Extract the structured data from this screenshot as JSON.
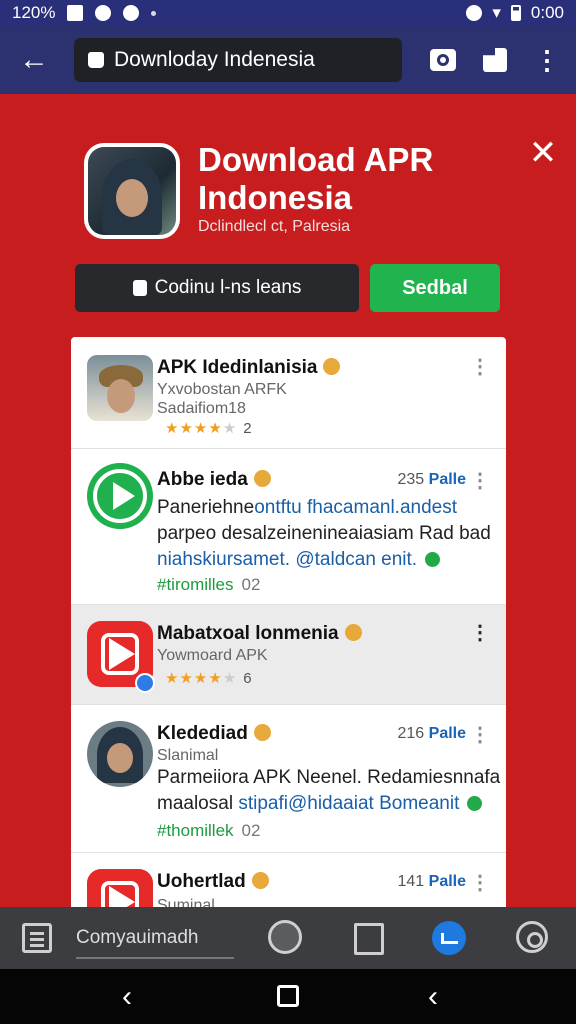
{
  "status_bar": {
    "time_left": "120%",
    "time_right": "0:00"
  },
  "appbar": {
    "search_text": "Downloday Indenesia"
  },
  "hero": {
    "title": "Download APR Indonesia",
    "subtitle": "Dclindlecl ct, Palresia",
    "primary_button": "Codinu l-ns leans",
    "secondary_button": "Sedbal"
  },
  "list": [
    {
      "title": "APK Idedinlanisia",
      "line1": "Yxvobostan ARFK",
      "line2": "Sadaifiom18",
      "rating": "2"
    },
    {
      "title": "Abbe ieda",
      "size_num": "235",
      "size_label": "Palle",
      "desc1": "Panerieh­ne",
      "desc1_hl": "ontftu fhacamanl.andest",
      "desc2": "parpeo desalzeinenineaiasiam Rad bad",
      "desc3_hl": "niahskiursamet. @taldcan enit.",
      "tag": "#tiromilles",
      "tag_num": "02"
    },
    {
      "title": "Mabatxoal lonmenia",
      "line1": "Yowmoard APK",
      "rating": "6"
    },
    {
      "title": "Kledediad",
      "size_num": "216",
      "size_label": "Palle",
      "line1": "Slanimal",
      "desc1": "Parmeiiora APK Neenel. Redamiesnnafa",
      "desc2": "maalosal",
      "desc2_hl": "stipafi@hidaaiat Bomeanit",
      "tag": "#thomillek",
      "tag_num": "02"
    },
    {
      "title": "Uohertlad",
      "size_num": "141",
      "size_label": "Palle",
      "line1": "Suminal"
    }
  ],
  "toolbar": {
    "input_text": "Comyauimadh"
  },
  "icons": [
    "back-arrow-icon",
    "lock-icon",
    "camera-icon",
    "share-icon",
    "more-icon",
    "close-icon",
    "document-icon",
    "clock-icon",
    "flag-icon",
    "check-icon",
    "settings-icon"
  ],
  "colors": {
    "brand_red": "#c71d1f",
    "appbar": "#2c3170",
    "green": "#21b34e",
    "link_blue": "#1a64b8"
  }
}
